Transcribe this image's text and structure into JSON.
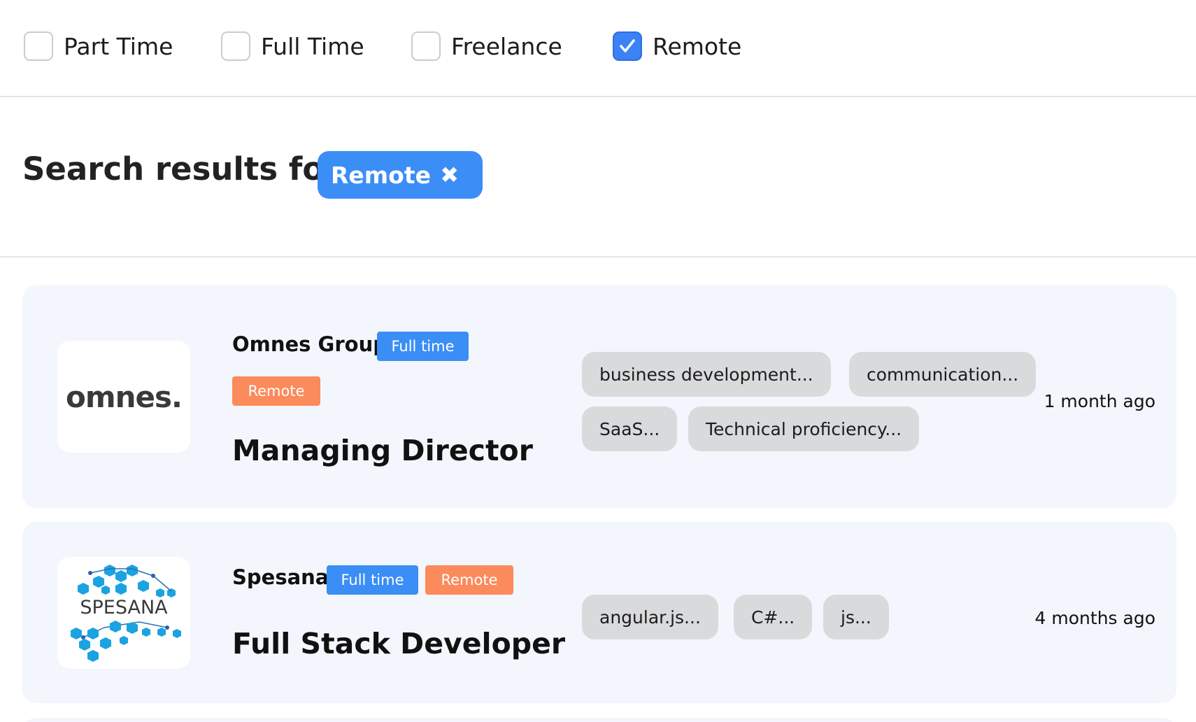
{
  "filters": [
    {
      "label": "Part Time",
      "checked": false
    },
    {
      "label": "Full Time",
      "checked": false
    },
    {
      "label": "Freelance",
      "checked": false
    },
    {
      "label": "Remote",
      "checked": true
    }
  ],
  "results": {
    "title": "Search results for:",
    "active_chip": "Remote",
    "chip_close_icon": "✖"
  },
  "jobs": [
    {
      "company": "Omnes Group",
      "logo_text": "omnes.",
      "badges": [
        "Full time",
        "Remote"
      ],
      "title": "Managing Director",
      "skills": [
        "business development...",
        "communication...",
        "SaaS...",
        "Technical proficiency..."
      ],
      "posted": "1 month ago"
    },
    {
      "company": "Spesana",
      "logo_text": "SPESANA",
      "badges": [
        "Full time",
        "Remote"
      ],
      "title": "Full Stack Developer",
      "skills": [
        "angular.js...",
        "C#...",
        "js..."
      ],
      "posted": "4 months ago"
    }
  ],
  "colors": {
    "accent": "#3b8ef5",
    "remote_badge": "#fb8a5c",
    "card_bg": "#f3f6fc",
    "skill_bg": "#d9dadc"
  }
}
